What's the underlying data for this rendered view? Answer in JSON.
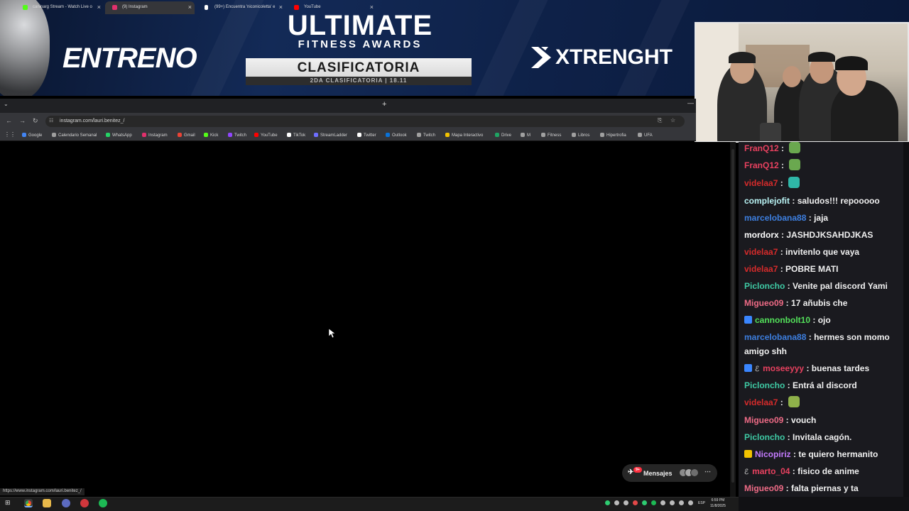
{
  "banner": {
    "left_text": "ENTRENO",
    "title": "ULTIMATE",
    "subtitle": "FITNESS AWARDS",
    "box_title": "CLASIFICATORIA",
    "box_sub": "2DA CLASIFICATORIA | 18.11",
    "sponsor": "XTRENGHT"
  },
  "browser": {
    "tabs": [
      {
        "label": "caninarg Stream - Watch Live o",
        "color": "#53fc18",
        "active": false
      },
      {
        "label": "(9) Instagram",
        "color": "#e1306c",
        "active": true
      },
      {
        "label": "(99+) Encuentra 'niconicoletta' e",
        "color": "#ffffff",
        "active": false
      },
      {
        "label": "YouTube",
        "color": "#ff0000",
        "active": false
      }
    ],
    "url": "instagram.com/lauri.benitez_/",
    "bookmarks": [
      {
        "label": "Google",
        "color": "#4285f4"
      },
      {
        "label": "Calendario Semanal",
        "color": "#9e9e9e"
      },
      {
        "label": "WhatsApp",
        "color": "#25d366"
      },
      {
        "label": "Instagram",
        "color": "#e1306c"
      },
      {
        "label": "Gmail",
        "color": "#ea4335"
      },
      {
        "label": "Kick",
        "color": "#53fc18"
      },
      {
        "label": "Twitch",
        "color": "#9146ff"
      },
      {
        "label": "YouTube",
        "color": "#ff0000"
      },
      {
        "label": "TikTok",
        "color": "#ffffff"
      },
      {
        "label": "StreamLadder",
        "color": "#6e6eff"
      },
      {
        "label": "Twitter",
        "color": "#ffffff"
      },
      {
        "label": "Outlook",
        "color": "#0a72d8"
      },
      {
        "label": "Twitch",
        "color": "#a0a0a0"
      },
      {
        "label": "Mapa Interactivo",
        "color": "#f2c200"
      },
      {
        "label": "Drive",
        "color": "#1fa463"
      },
      {
        "label": "M",
        "color": "#a0a0a0"
      },
      {
        "label": "Fitness",
        "color": "#a0a0a0"
      },
      {
        "label": "Libros",
        "color": "#a0a0a0"
      },
      {
        "label": "Hipertrofia",
        "color": "#a0a0a0"
      },
      {
        "label": "UFA",
        "color": "#a0a0a0"
      }
    ],
    "status_url": "https://www.instagram.com/lauri.benitez_/",
    "messages_label": "Mensajes",
    "messages_badge": "9+"
  },
  "taskbar": {
    "time": "6:59 PM",
    "date": "11/8/2025",
    "lang": "ESP"
  },
  "chat": {
    "messages": [
      {
        "user": "FranQ12",
        "color": "#e8415f",
        "text": "",
        "emote": "#6aa84f"
      },
      {
        "user": "FranQ12",
        "color": "#e8415f",
        "text": "",
        "emote": "#6aa84f"
      },
      {
        "user": "videlaa7",
        "color": "#d62b2b",
        "text": "",
        "emote": "#2fb7a8"
      },
      {
        "user": "complejofit",
        "color": "#b9f3f4",
        "text": "saludos!!! repooooo"
      },
      {
        "user": "marcelobana88",
        "color": "#3d7fe0",
        "text": "jaja"
      },
      {
        "user": "mordorx",
        "color": "#ffffff",
        "text": "JASHDJKSAHDJKAS"
      },
      {
        "user": "videlaa7",
        "color": "#d62b2b",
        "text": "invitenlo que vaya"
      },
      {
        "user": "videlaa7",
        "color": "#d62b2b",
        "text": "POBRE MATI"
      },
      {
        "user": "Picloncho",
        "color": "#3ec9a4",
        "text": "Venite pal discord Yami"
      },
      {
        "user": "Migueo09",
        "color": "#ee6b86",
        "text": "17 añubis che"
      },
      {
        "user": "cannonbolt10",
        "color": "#53e05a",
        "text": "ojo",
        "badge": "#3a86ff"
      },
      {
        "user": "marcelobana88",
        "color": "#3d7fe0",
        "text": "hermes son momo amigo shh"
      },
      {
        "user": "moseeyyy",
        "color": "#e8415f",
        "text": "buenas tardes",
        "badge": "#3a86ff",
        "badge2": "ℰ"
      },
      {
        "user": "Picloncho",
        "color": "#3ec9a4",
        "text": "Entrá al discord"
      },
      {
        "user": "videlaa7",
        "color": "#d62b2b",
        "text": "",
        "emote": "#8fb14a"
      },
      {
        "user": "Migueo09",
        "color": "#ee6b86",
        "text": "vouch"
      },
      {
        "user": "Picloncho",
        "color": "#3ec9a4",
        "text": "Invitala cagón."
      },
      {
        "user": "Nicopiriz",
        "color": "#c47bff",
        "text": "te quiero hermanito",
        "badge": "#f2c200"
      },
      {
        "user": "marto_04",
        "color": "#e8415f",
        "text": "fisico de anime",
        "badge2": "ℰ"
      },
      {
        "user": "Migueo09",
        "color": "#ee6b86",
        "text": "falta piernas y ta"
      }
    ]
  }
}
